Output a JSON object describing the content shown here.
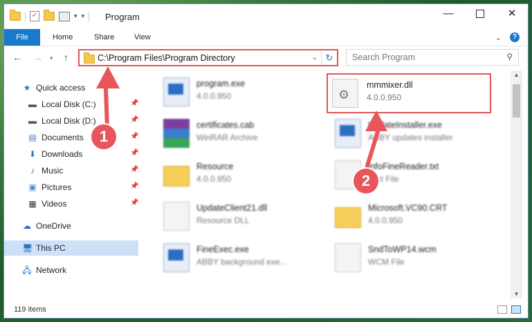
{
  "window": {
    "title": "Program"
  },
  "ribbon": {
    "tabs": [
      "File",
      "Home",
      "Share",
      "View"
    ]
  },
  "address": {
    "path": "C:\\Program Files\\Program Directory"
  },
  "search": {
    "placeholder": "Search Program"
  },
  "nav": {
    "quick_access": "Quick access",
    "items": [
      "Local Disk (C:)",
      "Local Disk (D:)",
      "Documents",
      "Downloads",
      "Music",
      "Pictures",
      "Videos"
    ],
    "onedrive": "OneDrive",
    "this_pc": "This PC",
    "network": "Network"
  },
  "files": [
    {
      "name": "program.exe",
      "sub": "4.0.0.950"
    },
    {
      "name": "mmmixer.dll",
      "sub": "4.0.0.950"
    },
    {
      "name": "certificates.cab",
      "sub": "WinRAR Archive"
    },
    {
      "name": "UpdateInstaller.exe",
      "sub": "ABBY updates installer"
    },
    {
      "name": "Resource",
      "sub": "4.0.0.950"
    },
    {
      "name": "InfoFineReader.txt",
      "sub": "Text File"
    },
    {
      "name": "UpdateClient21.dll",
      "sub": "Resource DLL"
    },
    {
      "name": "Microsoft.VC90.CRT",
      "sub": "4.0.0.950"
    },
    {
      "name": "FineExec.exe",
      "sub": "ABBY background exe..."
    },
    {
      "name": "SndToWP14.wcm",
      "sub": "WCM File"
    }
  ],
  "status": {
    "count": "119 items"
  },
  "callouts": [
    "1",
    "2"
  ],
  "colors": {
    "accent": "#1979ca",
    "highlight": "#e05555"
  }
}
